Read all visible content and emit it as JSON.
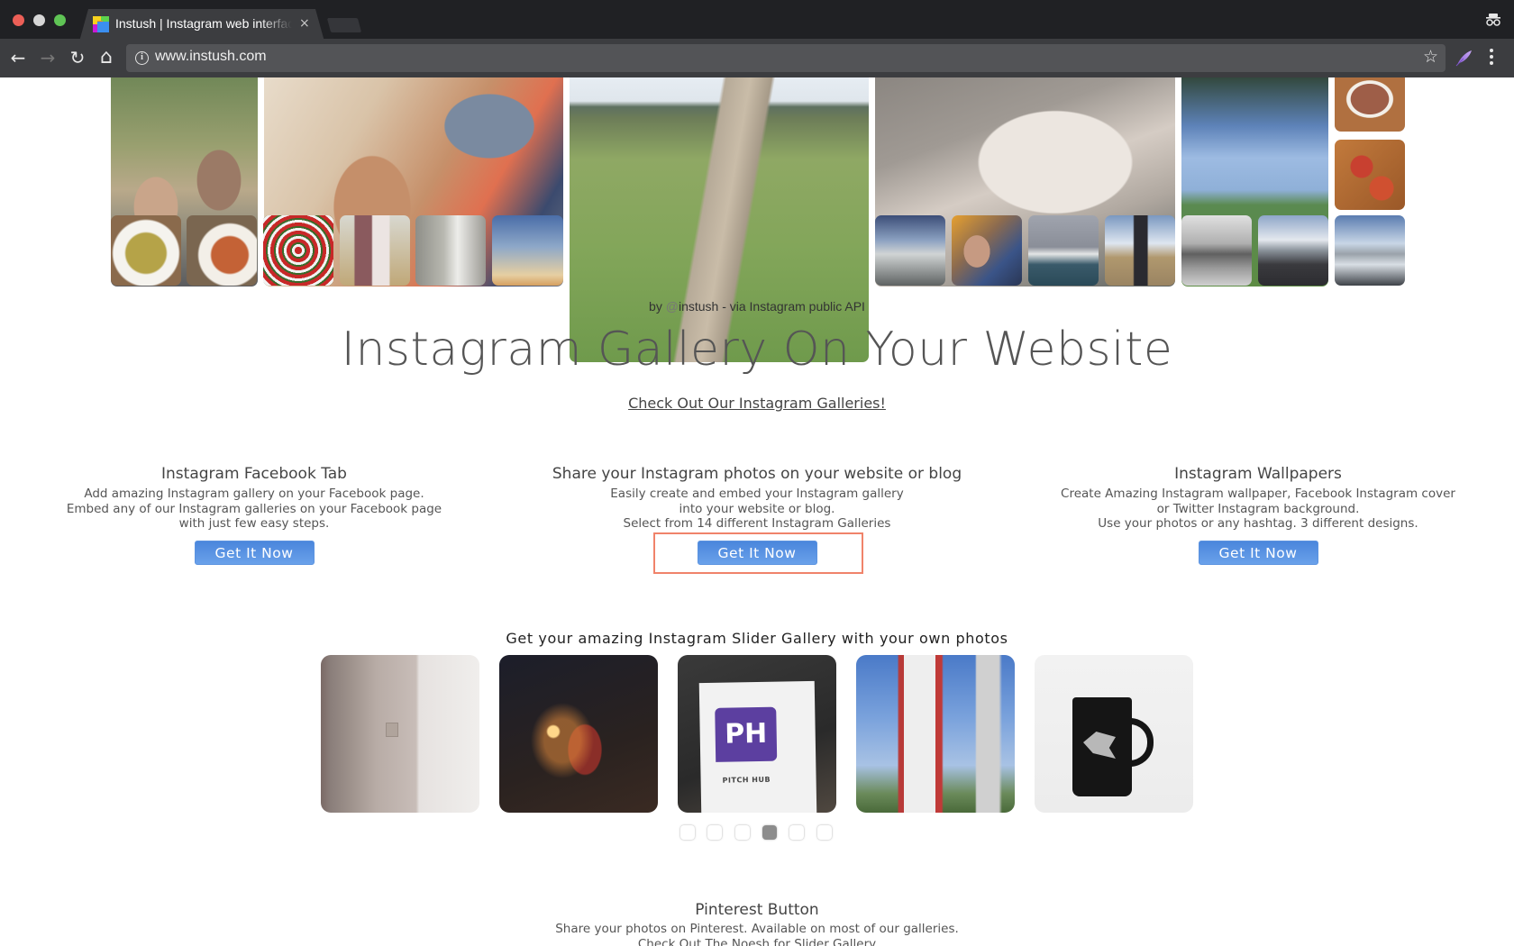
{
  "browser": {
    "tab_title": "Instush | Instagram web interface",
    "url": "www.instush.com",
    "icons": {
      "back": "arrow-left-icon",
      "forward": "arrow-right-icon",
      "reload": "reload-icon",
      "home": "home-icon",
      "info": "info-icon",
      "bookmark": "star-icon",
      "extension": "feather-icon",
      "menu": "more-vert-icon",
      "incognito": "incognito-icon",
      "close": "close-icon"
    },
    "glyphs": {
      "back": "←",
      "forward": "→",
      "reload": "↻",
      "home": "⌂",
      "info": "i",
      "star": "☆",
      "close": "×"
    }
  },
  "hero_gallery": {
    "photos": [
      "selfie of couple outdoors",
      "child in car seat",
      "canal through green fields",
      "bird plumage close-up",
      "trees and lawn under blue sky",
      "salad in oval dish",
      "mini pizzas",
      "pesto pasta",
      "pasta with sauce",
      "caprese skewers spiral",
      "couple at party",
      "man making pasta",
      "street lamp at sunset",
      "person on beach with sun",
      "selfie at cafe",
      "coastal town over sea",
      "woman on beach",
      "black and white person lying",
      "beach with waves",
      "rocky beach shoreline"
    ]
  },
  "caption": {
    "prefix": "by ",
    "at": "@",
    "handle": "instush",
    "suffix": " - via Instagram public API"
  },
  "headline": "Instagram Gallery On Your Website",
  "gallery_link": "Check Out Our Instagram Galleries!",
  "features": [
    {
      "title": "Instagram Facebook Tab",
      "lines": [
        "Add amazing Instagram gallery on your Facebook page.",
        "Embed any of our Instagram galleries on your Facebook page",
        "with just few easy steps."
      ],
      "button": "Get It Now"
    },
    {
      "title": "Share your Instagram photos on your website or blog",
      "lines": [
        "Easily create and embed your Instagram gallery",
        "into your website or blog.",
        "Select from 14 different Instagram Galleries"
      ],
      "button": "Get It Now"
    },
    {
      "title": "Instagram Wallpapers",
      "lines": [
        "Create Amazing Instagram wallpaper, Facebook Instagram cover",
        "or Twitter Instagram background.",
        "Use your photos or any hashtag. 3 different designs."
      ],
      "button": "Get It Now"
    }
  ],
  "slider": {
    "heading": "Get your amazing Instagram Slider Gallery with your own photos",
    "slides": [
      "elevator doors",
      "sparklers at night",
      "Pitch Hub sign",
      "high-rise apartment building",
      "Winter is Coming mug"
    ],
    "pitch_hub_logo": "PH",
    "pitch_hub_text": "PITCH HUB",
    "dots_total": 6,
    "active_dot": 4
  },
  "pinterest": {
    "title": "Pinterest Button",
    "line1": "Share your photos on Pinterest. Available on most of our galleries.",
    "line2": "Check Out The Noesh for Slider Gallery"
  },
  "colors": {
    "button_blue": "#4a86dc",
    "highlight_border": "#f0836a",
    "chrome_dark": "#202124",
    "chrome_toolbar": "#3c3d40"
  }
}
